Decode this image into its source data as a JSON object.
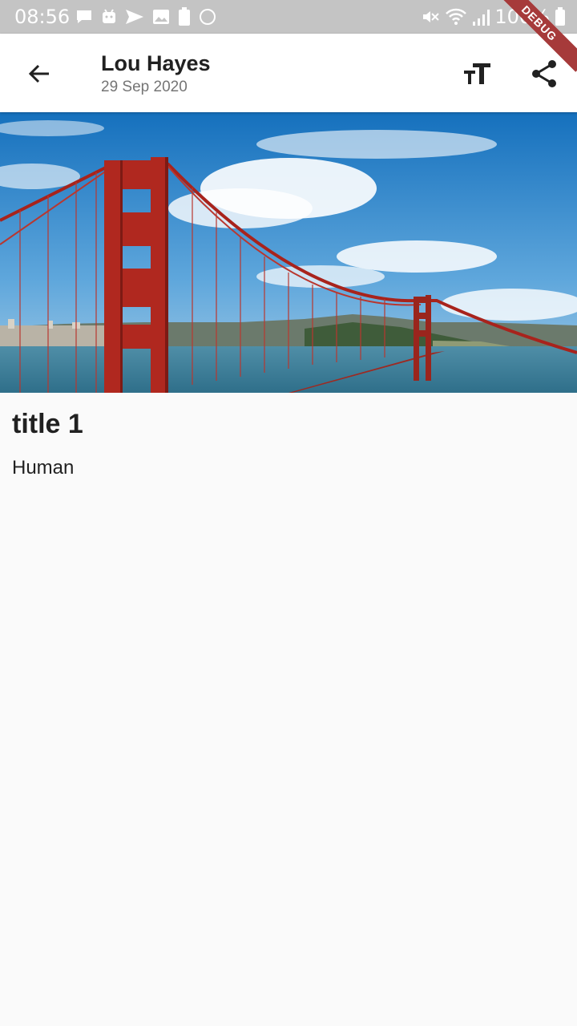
{
  "status_bar": {
    "time": "08:56",
    "battery_percent": "100%",
    "left_icons": [
      "message-icon",
      "android-icon",
      "send-icon",
      "image-icon",
      "battery-saver-icon",
      "circle-icon"
    ],
    "right_icons": [
      "mute-icon",
      "wifi-icon",
      "signal-icon",
      "battery-icon"
    ]
  },
  "debug_banner": "DEBUG",
  "app_bar": {
    "author": "Lou Hayes",
    "date": "29 Sep 2020",
    "actions": [
      "text-size-icon",
      "share-icon"
    ]
  },
  "article": {
    "title": "title 1",
    "body": "Human"
  },
  "colors": {
    "status_bar_bg": "#c4c4c4",
    "app_bar_bg": "#ffffff",
    "page_bg": "#fafafa",
    "debug_ribbon": "#a63a3a",
    "bridge_red": "#b22222",
    "sky_blue": "#1f7ec8"
  }
}
